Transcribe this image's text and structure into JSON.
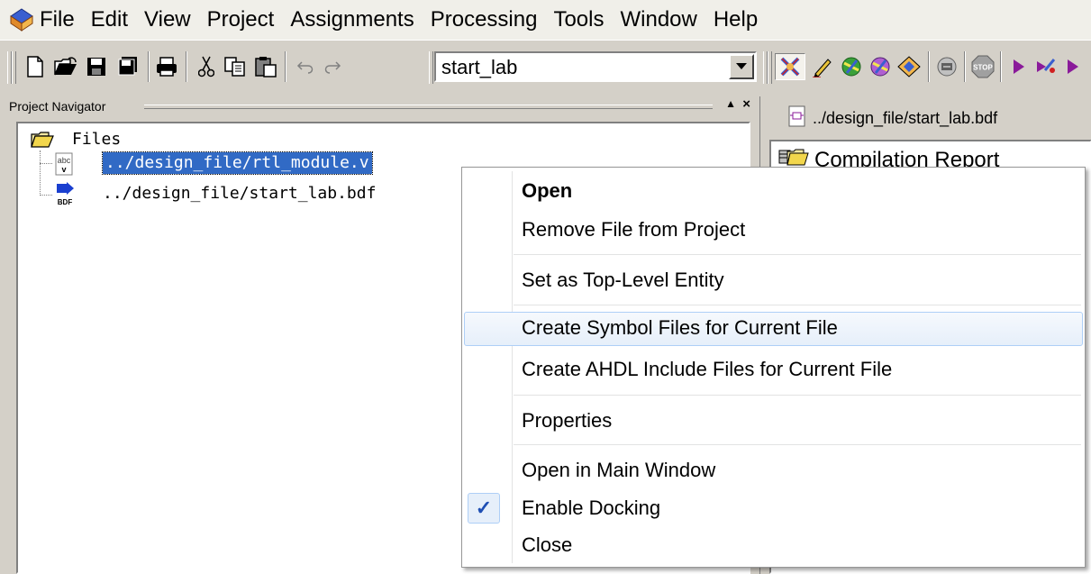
{
  "menubar": {
    "app_icon": "quartus-app-icon",
    "items": [
      "File",
      "Edit",
      "View",
      "Project",
      "Assignments",
      "Processing",
      "Tools",
      "Window",
      "Help"
    ]
  },
  "toolbar": {
    "buttons": [
      "new-icon",
      "open-icon",
      "save-icon",
      "save-all-icon",
      "print-icon",
      "cut-icon",
      "copy-icon",
      "paste-icon",
      "undo-icon",
      "redo-icon",
      "compiler-icon",
      "edit-icon",
      "analysis-icon",
      "fitter-icon",
      "assembler-icon",
      "timing-icon",
      "stop-icon",
      "start-icon",
      "start-analysis-icon"
    ],
    "project_combo_value": "start_lab"
  },
  "navigator": {
    "title": "Project Navigator",
    "tree": {
      "root_label": "Files",
      "files": [
        {
          "label": "../design_file/rtl_module.v",
          "icon": "verilog-file-icon",
          "icon_text": "abc",
          "icon_sub": "v",
          "selected": true
        },
        {
          "label": "../design_file/start_lab.bdf",
          "icon": "bdf-file-icon",
          "icon_text": "BDF",
          "selected": false
        }
      ]
    }
  },
  "right_pane": {
    "tab_label": "../design_file/start_lab.bdf",
    "report_label": "Compilation Report"
  },
  "context_menu": {
    "items": [
      {
        "label": "Open",
        "bold": true
      },
      {
        "label": "Remove File from Project"
      },
      {
        "label": "Set as Top-Level Entity"
      },
      {
        "label": "Create Symbol Files for Current File",
        "hover": true
      },
      {
        "label": "Create AHDL Include Files for Current File"
      },
      {
        "label": "Properties"
      },
      {
        "label": "Open in Main Window"
      },
      {
        "label": "Enable Docking",
        "checked": true
      },
      {
        "label": "Close"
      }
    ],
    "check_glyph": "✓"
  },
  "colors": {
    "selection": "#316ac5",
    "menu_hover_border": "#aecff7",
    "check": "#1f4fb4",
    "chrome": "#d4d0c8"
  }
}
